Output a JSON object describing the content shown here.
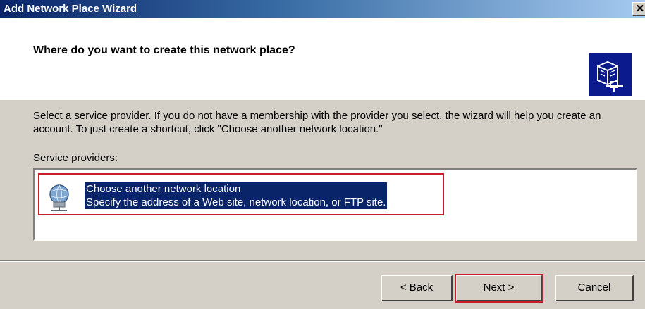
{
  "window": {
    "title": "Add Network Place Wizard",
    "close_glyph": "✕"
  },
  "header": {
    "question": "Where do you want to create this network place?",
    "icon": "network-folder-icon"
  },
  "body": {
    "description": "Select a service provider.  If you do not have a membership with the provider you select, the wizard will help you create an account.  To just create a shortcut, click \"Choose another network location.\"",
    "providers_label": "Service providers:",
    "providers": [
      {
        "title": "Choose another network location",
        "subtitle": "Specify the address of a Web site, network location, or FTP site.",
        "icon": "network-globe-icon",
        "selected": true
      }
    ]
  },
  "buttons": {
    "back": "< Back",
    "next": "Next >",
    "cancel": "Cancel"
  },
  "colors": {
    "title_gradient_start": "#0a246a",
    "selection": "#0a246a",
    "highlight_box": "#c81e2a",
    "dialog_face": "#d4d0c8"
  }
}
